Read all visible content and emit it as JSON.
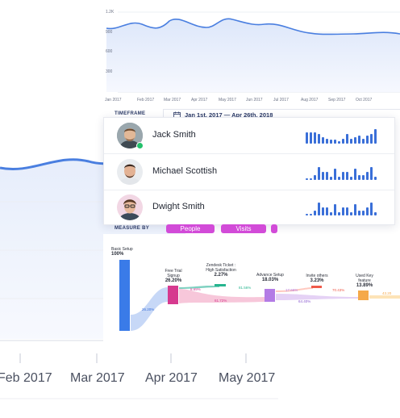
{
  "background_chart": {
    "x_labels": [
      "Feb 2017",
      "Mar 2017",
      "Apr 2017",
      "May 2017"
    ]
  },
  "top_chart": {
    "y_ticks": [
      "1.2K",
      "900",
      "600",
      "300"
    ],
    "x_ticks": [
      "Jan 2017",
      "Feb 2017",
      "Mar 2017",
      "Apr 2017",
      "May 2017",
      "Jun 2017",
      "Jul 2017",
      "Aug 2017",
      "Sep 2017",
      "Oct 2017"
    ],
    "line_color": "#4a7fe0"
  },
  "timeframe": {
    "label": "TIMEFRAME",
    "range": "Jan 1st, 2017 — Apr 26th, 2018",
    "icon": "calendar-icon"
  },
  "people": [
    {
      "name": "Jack Smith",
      "online": true
    },
    {
      "name": "Michael Scottish",
      "online": false
    },
    {
      "name": "Dwight Smith",
      "online": false
    }
  ],
  "measure_by": {
    "label": "MEASURE BY",
    "options": [
      "People",
      "Visits"
    ],
    "accent": "#d24bd8"
  },
  "funnel": {
    "steps": [
      {
        "label": "Basic Setup",
        "value": "100%"
      },
      {
        "label": "Free Trial Signup",
        "value": "26.20%"
      },
      {
        "label": "Zendesk Ticket : High Satisfaction",
        "value": "2.27%"
      },
      {
        "label": "Advance Setup",
        "value": "18.03%"
      },
      {
        "label": "Invite others",
        "value": "3.23%"
      },
      {
        "label": "Used Key feature",
        "value": "13.89%"
      }
    ],
    "flows": [
      "26.20%",
      "8.69%",
      "81.56%",
      "61.72%",
      "17.66%",
      "70.43%",
      "64.40%",
      "43.20"
    ]
  }
}
